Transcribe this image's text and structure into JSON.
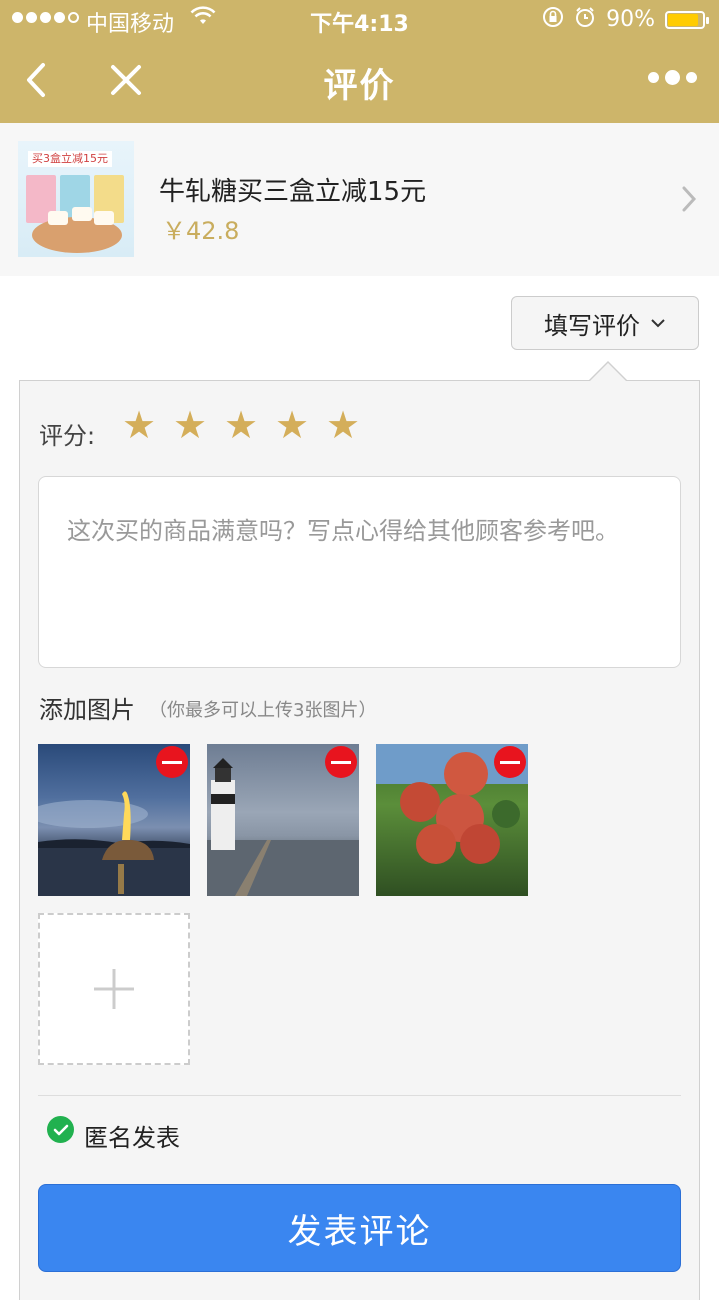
{
  "status_bar": {
    "carrier": "中国移动",
    "time": "下午4:13",
    "battery_percent": "90%",
    "battery_level": 0.9,
    "signal_bars": 4,
    "icons": [
      "wifi-icon",
      "rotation-lock-icon",
      "alarm-icon",
      "battery-icon"
    ]
  },
  "nav": {
    "title": "评价",
    "icons": [
      "back-icon",
      "close-icon",
      "more-icon"
    ]
  },
  "product": {
    "name": "牛轧糖买三盒立减15元",
    "price": "￥42.8",
    "image_tag": "买3盒立减15元"
  },
  "review": {
    "toggle_label": "填写评价",
    "rating_label": "评分:",
    "stars": 5,
    "star_color": "#d4ae5a",
    "placeholder": "这次买的商品满意吗？写点心得给其他顾客参考吧。",
    "add_photos_title": "添加图片",
    "add_photos_hint": "（你最多可以上传3张图片）",
    "photos": [
      "statue-at-dusk",
      "lighthouse-by-sea",
      "lychee-fruit"
    ],
    "anonymous_label": "匿名发表",
    "anonymous_checked": true,
    "submit_label": "发表评论"
  },
  "colors": {
    "header": "#cdb56a",
    "price": "#c9ad5e",
    "submit": "#3a86f0",
    "check": "#21b14f",
    "remove": "#e8141e"
  }
}
